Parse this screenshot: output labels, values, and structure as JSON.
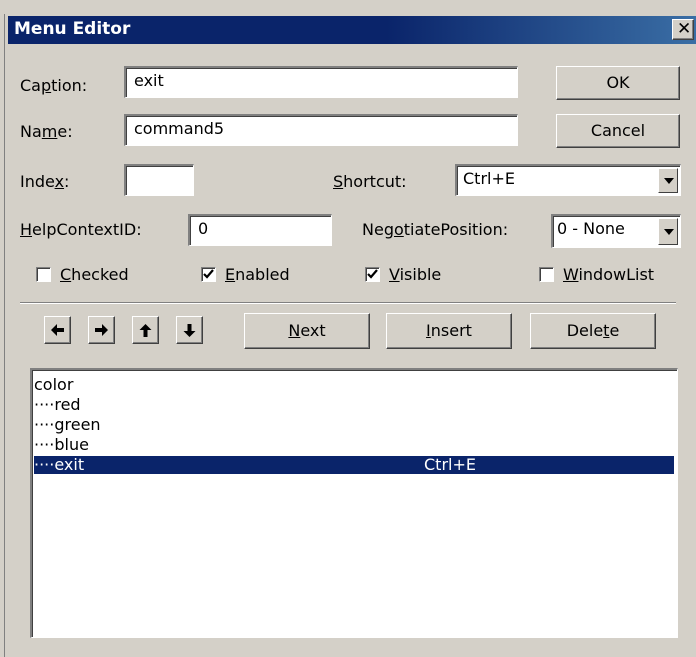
{
  "window": {
    "title": "Menu Editor",
    "close_glyph": "✕"
  },
  "caption": {
    "label_pre": "Ca",
    "label_key": "p",
    "label_post": "tion:",
    "value": "exit"
  },
  "name": {
    "label_pre": "Na",
    "label_key": "m",
    "label_post": "e:",
    "value": "command5"
  },
  "index": {
    "label_pre": "Inde",
    "label_key": "x",
    "label_post": ":",
    "value": ""
  },
  "shortcut": {
    "label_key": "S",
    "label_post": "hortcut:",
    "value": "Ctrl+E"
  },
  "helpcontext": {
    "label_key": "H",
    "label_post": "elpContextID:",
    "value": "0"
  },
  "negotiate": {
    "label_pre": "Neg",
    "label_key": "o",
    "label_post": "tiatePosition:",
    "value": "0 - None"
  },
  "checkboxes": {
    "checked": {
      "key": "C",
      "rest": "hecked",
      "state": false
    },
    "enabled": {
      "key": "E",
      "rest": "nabled",
      "state": true
    },
    "visible": {
      "key": "V",
      "rest": "isible",
      "state": true
    },
    "windowlist": {
      "key": "W",
      "rest": "indowList",
      "state": false
    }
  },
  "buttons": {
    "ok": "OK",
    "cancel": "Cancel",
    "next_key": "N",
    "next_rest": "ext",
    "insert_key": "I",
    "insert_rest": "nsert",
    "delete_pre": "Dele",
    "delete_key": "t",
    "delete_post": "e"
  },
  "arrows": [
    "left-arrow-icon",
    "right-arrow-icon",
    "up-arrow-icon",
    "down-arrow-icon"
  ],
  "menu_items": [
    {
      "text": "color",
      "shortcut": "",
      "selected": false
    },
    {
      "text": "····red",
      "shortcut": "",
      "selected": false
    },
    {
      "text": "····green",
      "shortcut": "",
      "selected": false
    },
    {
      "text": "····blue",
      "shortcut": "",
      "selected": false
    },
    {
      "text": "····exit",
      "shortcut": "Ctrl+E",
      "selected": true
    }
  ],
  "colors": {
    "titlebar": "#0a246a",
    "face": "#d4d0c8",
    "selection": "#0a246a"
  }
}
